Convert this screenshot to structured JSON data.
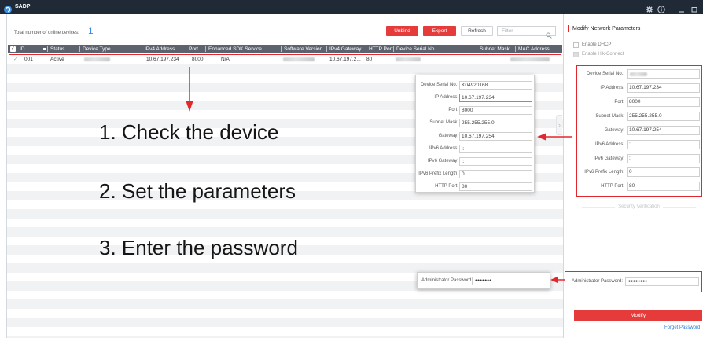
{
  "app": {
    "title": "SADP"
  },
  "icons": {
    "logo": "sadp-logo-icon",
    "settings": "gear-icon",
    "about": "info-icon",
    "minimize": "minimize-icon",
    "maximize": "maximize-icon",
    "search": "search-icon",
    "row_check": "check-icon",
    "collapse": "chevron-right-icon"
  },
  "colors": {
    "titlebar": "#1f2a36",
    "accent_red": "#e63b3b",
    "table_header": "#5c636f",
    "count_blue": "#3b8ae0",
    "link_blue": "#2f7fd8",
    "annotation_red": "#e0282d"
  },
  "summary": {
    "label": "Total number of online devices:",
    "count": "1"
  },
  "toolbar": {
    "unbind": "Unbind",
    "export": "Export",
    "refresh": "Refresh",
    "filter_placeholder": "Filter"
  },
  "table": {
    "headers": [
      "ID",
      "Status",
      "Device Type",
      "IPv4 Address",
      "Port",
      "Enhanced SDK Service ...",
      "Software Version",
      "IPv4 Gateway",
      "HTTP Port",
      "Device Serial No.",
      "Subnet Mask",
      "MAC Address"
    ],
    "rows": [
      {
        "check": "✓",
        "id": "001",
        "status": "Active",
        "ipv4": "10.67.197.234",
        "port": "8000",
        "enhanced_sdk": "N/A",
        "ipv4_gateway": "10.67.197.2...",
        "http_port": "80"
      }
    ]
  },
  "annotations": [
    "1. Check the device",
    "2. Set the parameters",
    "3. Enter the password"
  ],
  "params_popup": {
    "fields": [
      {
        "label": "Device Serial No.:",
        "value": "K04920168"
      },
      {
        "label": "IP Address:",
        "value": "10.67.197.234"
      },
      {
        "label": "Port:",
        "value": "8000"
      },
      {
        "label": "Subnet Mask:",
        "value": "255.255.255.0"
      },
      {
        "label": "Gateway:",
        "value": "10.67.197.254"
      },
      {
        "label": "IPv6 Address:",
        "value": "::"
      },
      {
        "label": "IPv6 Gateway:",
        "value": "::"
      },
      {
        "label": "IPv6 Prefix Length:",
        "value": "0"
      },
      {
        "label": "HTTP Port:",
        "value": "80"
      }
    ]
  },
  "password_popup": {
    "label": "Administrator Password:",
    "value": "●●●●●●●"
  },
  "panel": {
    "title": "Modify Network Parameters",
    "dhcp_label": "Enable DHCP",
    "hik_connect_label": "Enable Hik-Connect",
    "fields": [
      {
        "label": "Device Serial No.:"
      },
      {
        "label": "IP Address:",
        "value": "10.67.197.234"
      },
      {
        "label": "Port:",
        "value": "8000"
      },
      {
        "label": "Subnet Mask:",
        "value": "255.255.255.0"
      },
      {
        "label": "Gateway:",
        "value": "10.67.197.254"
      },
      {
        "label": "IPv6 Address:",
        "value": "::"
      },
      {
        "label": "IPv6 Gateway:",
        "value": "::"
      },
      {
        "label": "IPv6 Prefix Length:",
        "value": "0"
      },
      {
        "label": "HTTP Port:",
        "value": "80"
      }
    ],
    "security_label": "Security Verification",
    "password_label": "Administrator Password:",
    "password_value": "●●●●●●●●",
    "modify_label": "Modify",
    "forget_label": "Forget Password"
  }
}
